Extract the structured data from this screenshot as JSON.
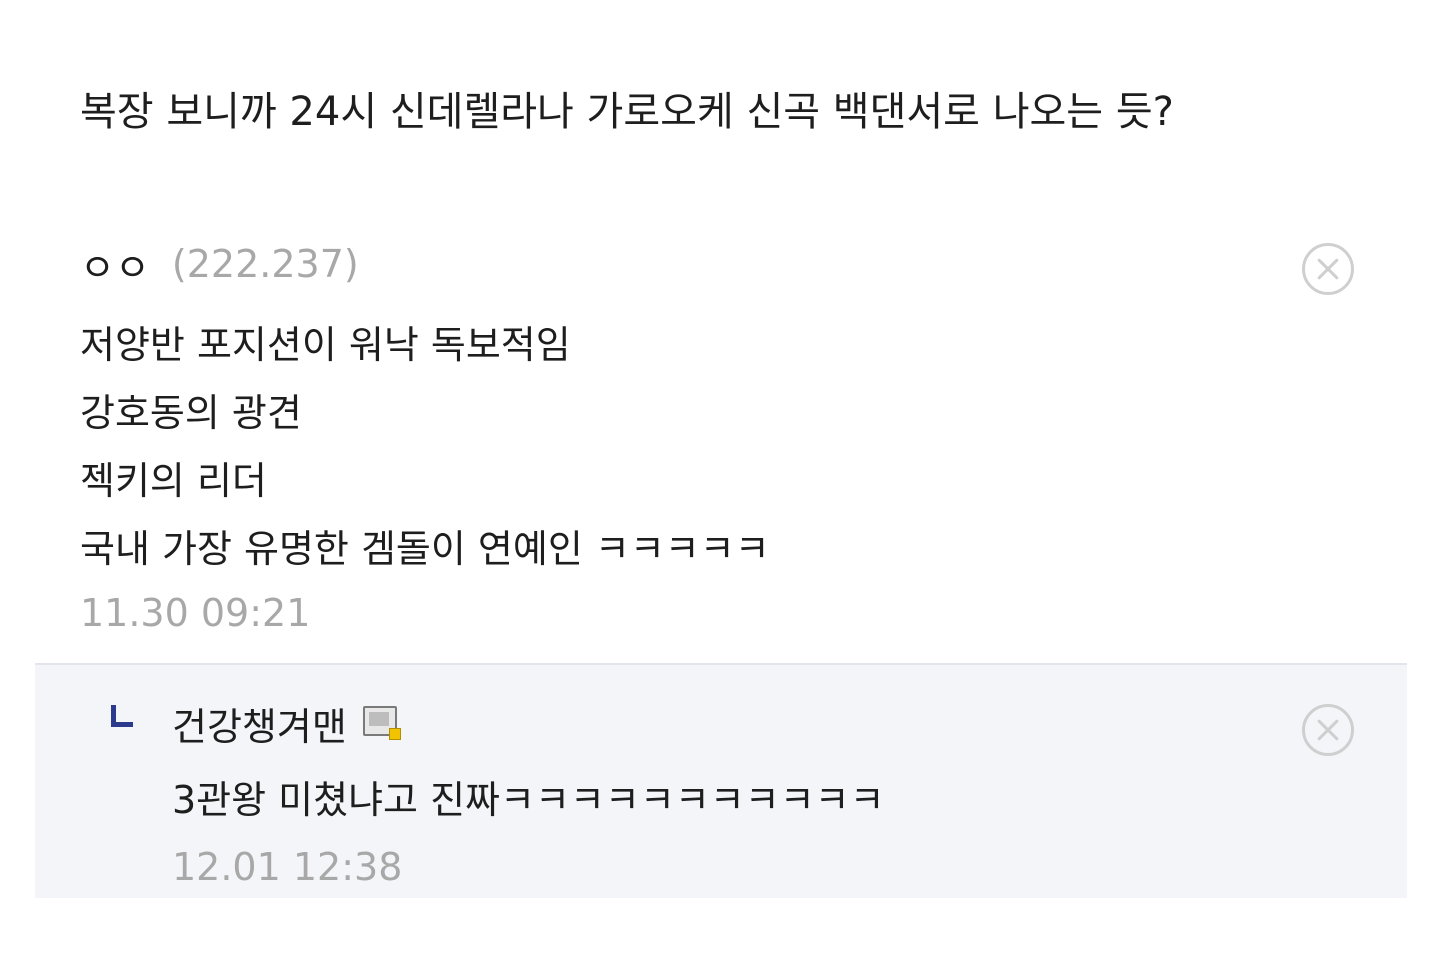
{
  "post": {
    "text": "복장 보니까 24시 신데렐라나 가로오케 신곡 백댄서로 나오는 듯?"
  },
  "comments": [
    {
      "author": "ㅇㅇ",
      "ip": "(222.237)",
      "lines": [
        "저양반 포지션이 워낙 독보적임",
        "강호동의 광견",
        "젝키의 리더",
        "국내 가장 유명한 겜돌이 연예인 ㅋㅋㅋㅋㅋ"
      ],
      "timestamp": "11.30 09:21",
      "delete_icon": "close-circle-icon"
    }
  ],
  "reply": {
    "indicator_icon": "reply-arrow-icon",
    "author": "건강챙겨맨",
    "author_badge_icon": "gallery-member-icon",
    "text": "3관왕 미쳤냐고 진짜ㅋㅋㅋㅋㅋㅋㅋㅋㅋㅋㅋ",
    "timestamp": "12.01 12:38",
    "delete_icon": "close-circle-icon"
  },
  "colors": {
    "text": "#1e1e1e",
    "muted": "#a8a8a8",
    "reply_bg": "#f3f5f9",
    "reply_indicator": "#2b3a8c",
    "divider": "#e2e5ec"
  }
}
